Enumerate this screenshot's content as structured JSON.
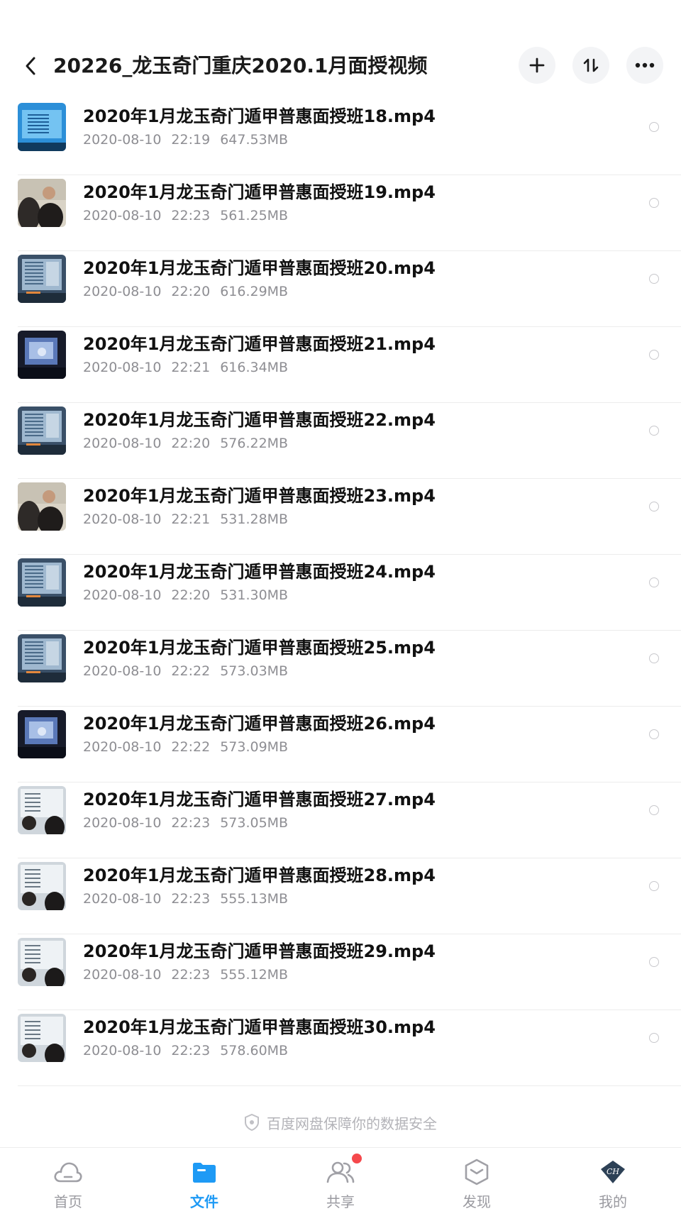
{
  "header": {
    "title": "20226_龙玉奇门重庆2020.1月面授视频"
  },
  "files": [
    {
      "name": "2020年1月龙玉奇门遁甲普惠面授班18.mp4",
      "date": "2020-08-10",
      "time": "22:19",
      "size": "647.53MB",
      "thumb": "blue"
    },
    {
      "name": "2020年1月龙玉奇门遁甲普惠面授班19.mp4",
      "date": "2020-08-10",
      "time": "22:23",
      "size": "561.25MB",
      "thumb": "people"
    },
    {
      "name": "2020年1月龙玉奇门遁甲普惠面授班20.mp4",
      "date": "2020-08-10",
      "time": "22:20",
      "size": "616.29MB",
      "thumb": "screen"
    },
    {
      "name": "2020年1月龙玉奇门遁甲普惠面授班21.mp4",
      "date": "2020-08-10",
      "time": "22:21",
      "size": "616.34MB",
      "thumb": "dark"
    },
    {
      "name": "2020年1月龙玉奇门遁甲普惠面授班22.mp4",
      "date": "2020-08-10",
      "time": "22:20",
      "size": "576.22MB",
      "thumb": "screen"
    },
    {
      "name": "2020年1月龙玉奇门遁甲普惠面授班23.mp4",
      "date": "2020-08-10",
      "time": "22:21",
      "size": "531.28MB",
      "thumb": "people"
    },
    {
      "name": "2020年1月龙玉奇门遁甲普惠面授班24.mp4",
      "date": "2020-08-10",
      "time": "22:20",
      "size": "531.30MB",
      "thumb": "screen"
    },
    {
      "name": "2020年1月龙玉奇门遁甲普惠面授班25.mp4",
      "date": "2020-08-10",
      "time": "22:22",
      "size": "573.03MB",
      "thumb": "screen"
    },
    {
      "name": "2020年1月龙玉奇门遁甲普惠面授班26.mp4",
      "date": "2020-08-10",
      "time": "22:22",
      "size": "573.09MB",
      "thumb": "dark"
    },
    {
      "name": "2020年1月龙玉奇门遁甲普惠面授班27.mp4",
      "date": "2020-08-10",
      "time": "22:23",
      "size": "573.05MB",
      "thumb": "board"
    },
    {
      "name": "2020年1月龙玉奇门遁甲普惠面授班28.mp4",
      "date": "2020-08-10",
      "time": "22:23",
      "size": "555.13MB",
      "thumb": "board"
    },
    {
      "name": "2020年1月龙玉奇门遁甲普惠面授班29.mp4",
      "date": "2020-08-10",
      "time": "22:23",
      "size": "555.12MB",
      "thumb": "board"
    },
    {
      "name": "2020年1月龙玉奇门遁甲普惠面授班30.mp4",
      "date": "2020-08-10",
      "time": "22:23",
      "size": "578.60MB",
      "thumb": "board"
    }
  ],
  "notice": "百度网盘保障你的数据安全",
  "nav": [
    {
      "label": "首页",
      "icon": "cloud-icon",
      "active": false
    },
    {
      "label": "文件",
      "icon": "folder-icon",
      "active": true
    },
    {
      "label": "共享",
      "icon": "people-icon",
      "active": false,
      "badge": true
    },
    {
      "label": "发现",
      "icon": "hexagon-icon",
      "active": false
    },
    {
      "label": "我的",
      "icon": "avatar-icon",
      "active": false
    }
  ],
  "colors": {
    "accent": "#1e9af5",
    "badge": "#f5484c",
    "meta_text": "#8e8e93"
  }
}
